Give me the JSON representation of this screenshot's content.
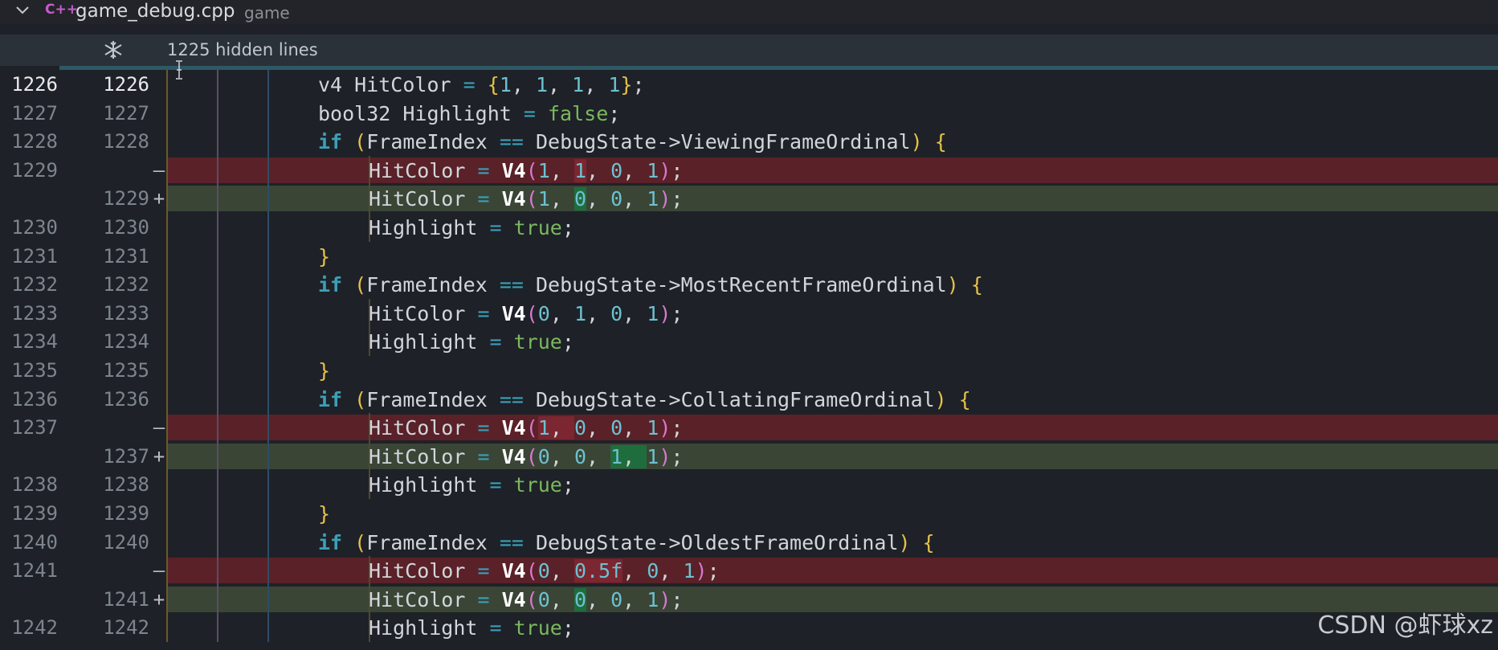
{
  "file_header": {
    "file_name": "game_debug.cpp",
    "folder": "game",
    "lang_icon": "C++"
  },
  "hidden_bar": {
    "label": "1225 hidden lines"
  },
  "rows": [
    {
      "type": "ctx",
      "old": "1226",
      "new": "1226",
      "indent": 2
    },
    {
      "type": "ctx",
      "old": "1227",
      "new": "1227",
      "indent": 2
    },
    {
      "type": "ctx",
      "old": "1228",
      "new": "1228",
      "indent": 2
    },
    {
      "type": "del",
      "old": "1229",
      "new": "",
      "indent": 3
    },
    {
      "type": "add",
      "old": "",
      "new": "1229",
      "indent": 3
    },
    {
      "type": "ctx",
      "old": "1230",
      "new": "1230",
      "indent": 3
    },
    {
      "type": "ctx",
      "old": "1231",
      "new": "1231",
      "indent": 2
    },
    {
      "type": "ctx",
      "old": "1232",
      "new": "1232",
      "indent": 2
    },
    {
      "type": "ctx",
      "old": "1233",
      "new": "1233",
      "indent": 3
    },
    {
      "type": "ctx",
      "old": "1234",
      "new": "1234",
      "indent": 3
    },
    {
      "type": "ctx",
      "old": "1235",
      "new": "1235",
      "indent": 2
    },
    {
      "type": "ctx",
      "old": "1236",
      "new": "1236",
      "indent": 2
    },
    {
      "type": "del",
      "old": "1237",
      "new": "",
      "indent": 3
    },
    {
      "type": "add",
      "old": "",
      "new": "1237",
      "indent": 3
    },
    {
      "type": "ctx",
      "old": "1238",
      "new": "1238",
      "indent": 3
    },
    {
      "type": "ctx",
      "old": "1239",
      "new": "1239",
      "indent": 2
    },
    {
      "type": "ctx",
      "old": "1240",
      "new": "1240",
      "indent": 2
    },
    {
      "type": "del",
      "old": "1241",
      "new": "",
      "indent": 3
    },
    {
      "type": "add",
      "old": "",
      "new": "1241",
      "indent": 3
    },
    {
      "type": "ctx",
      "old": "1242",
      "new": "1242",
      "indent": 3
    }
  ],
  "code_lines": [
    "v4 HitColor = {1, 1, 1, 1};",
    "bool32 Highlight = false;",
    "if (FrameIndex == DebugState->ViewingFrameOrdinal) {",
    "HitColor = V4(1, 1, 0, 1);",
    "HitColor = V4(1, 0, 0, 1);",
    "Highlight = true;",
    "}",
    "if (FrameIndex == DebugState->MostRecentFrameOrdinal) {",
    "HitColor = V4(0, 1, 0, 1);",
    "Highlight = true;",
    "}",
    "if (FrameIndex == DebugState->CollatingFrameOrdinal) {",
    "HitColor = V4(1, 0, 0, 1);",
    "HitColor = V4(0, 0, 1, 1);",
    "Highlight = true;",
    "}",
    "if (FrameIndex == DebugState->OldestFrameOrdinal) {",
    "HitColor = V4(0, 0.5f, 0, 1);",
    "HitColor = V4(0, 0, 0, 1);",
    "Highlight = true;"
  ],
  "diff_markers": {
    "deleted": "—",
    "added": "+"
  },
  "watermark": "CSDN @虾球xz",
  "colors": {
    "deleted_row": "#5a2128",
    "added_row": "#3a4536",
    "keyword": "#3ba0b7",
    "number": "#6cc1d0",
    "bool": "#7bb85e"
  }
}
